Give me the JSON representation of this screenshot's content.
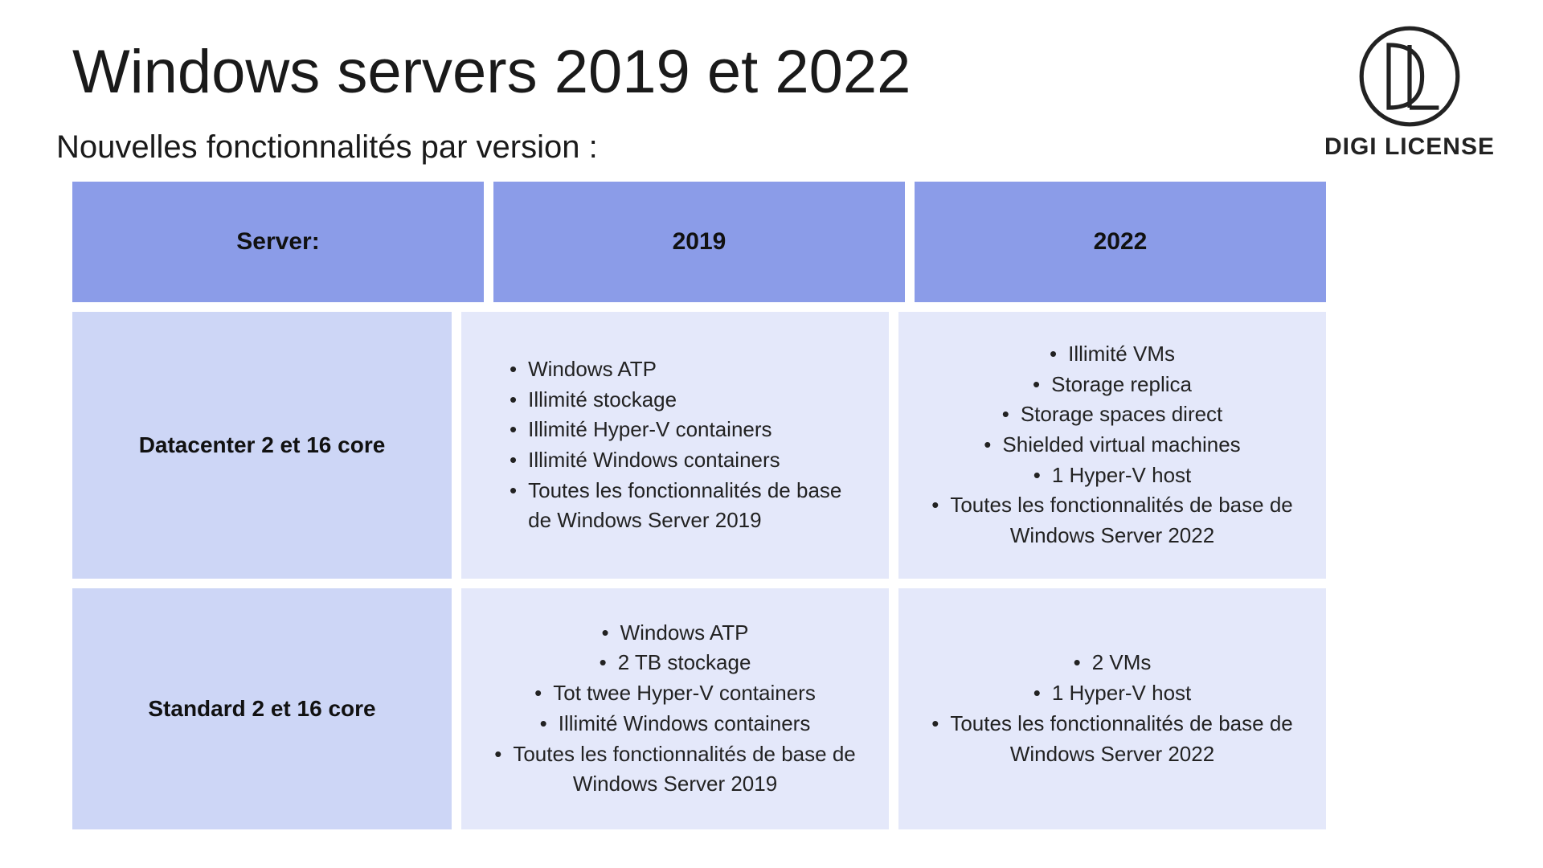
{
  "brand": {
    "name": "DIGI LICENSE"
  },
  "title": "Windows servers 2019 et 2022",
  "subtitle": "Nouvelles fonctionnalités par version :",
  "table": {
    "headers": [
      "Server:",
      "2019",
      "2022"
    ],
    "rows": [
      {
        "label": "Datacenter 2 et 16 core",
        "col2019": [
          "Windows ATP",
          "Illimité stockage",
          "Illimité Hyper-V containers",
          "Illimité Windows containers",
          "Toutes les fonctionnalités de base de Windows Server 2019"
        ],
        "col2022": [
          "Illimité VMs",
          "Storage replica",
          "Storage spaces direct",
          "Shielded virtual machines",
          "1 Hyper-V host",
          "Toutes les fonctionnalités de base de Windows Server 2022"
        ]
      },
      {
        "label": "Standard 2 et 16 core",
        "col2019": [
          "Windows ATP",
          "2 TB stockage",
          "Tot twee Hyper-V containers",
          "Illimité Windows containers",
          "Toutes les fonctionnalités de base de Windows Server 2019"
        ],
        "col2022": [
          "2 VMs",
          "1 Hyper-V host",
          "Toutes les fonctionnalités de base de Windows Server 2022"
        ]
      }
    ]
  }
}
